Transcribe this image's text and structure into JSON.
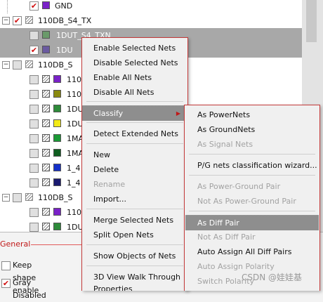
{
  "tree": {
    "rows": [
      {
        "label": "GND",
        "icon": "purple"
      },
      {
        "label": "110DB_S4_TX",
        "group": true
      },
      {
        "label": "1DUT_S4_TXN",
        "icon": "green"
      },
      {
        "label": "1DU",
        "icon": "purple"
      },
      {
        "label": "110DB_S",
        "group": true
      },
      {
        "label": "110",
        "icon": "purple"
      },
      {
        "label": "110",
        "icon": "olive"
      },
      {
        "label": "1DU",
        "icon": "green"
      },
      {
        "label": "1DU",
        "icon": "yellow"
      },
      {
        "label": "1MA",
        "icon": "green"
      },
      {
        "label": "1MA",
        "icon": "darkgreen"
      },
      {
        "label": "1_4",
        "icon": "blue"
      },
      {
        "label": "1_4",
        "icon": "navy"
      },
      {
        "label": "110DB_S",
        "group": true
      },
      {
        "label": "110",
        "icon": "purple"
      },
      {
        "label": "1DU",
        "icon": "green"
      }
    ]
  },
  "general": {
    "title": "General",
    "options": [
      {
        "label": "Keep shape enable"
      },
      {
        "label": "Gray Disabled"
      }
    ]
  },
  "context_menu": {
    "items": [
      {
        "label": "Enable Selected Nets"
      },
      {
        "label": "Disable Selected Nets"
      },
      {
        "label": "Enable All Nets"
      },
      {
        "label": "Disable All Nets"
      },
      {
        "label": "Classify"
      },
      {
        "label": "Detect Extended Nets"
      },
      {
        "label": "New"
      },
      {
        "label": "Delete"
      },
      {
        "label": "Rename"
      },
      {
        "label": "Import..."
      },
      {
        "label": "Merge Selected Nets"
      },
      {
        "label": "Split Open Nets"
      },
      {
        "label": "Show Objects of Nets"
      },
      {
        "label": "3D View Walk Through"
      },
      {
        "label": "Properties"
      }
    ]
  },
  "submenu": {
    "items": [
      {
        "label": "As PowerNets"
      },
      {
        "label": "As GroundNets"
      },
      {
        "label": "As Signal Nets"
      },
      {
        "label": "P/G nets classification wizard..."
      },
      {
        "label": "As Power-Ground Pair"
      },
      {
        "label": "Not As Power-Ground Pair"
      },
      {
        "label": "As Diff Pair"
      },
      {
        "label": "Not As Diff Pair"
      },
      {
        "label": "Auto Assign All Diff Pairs"
      },
      {
        "label": "Auto Assign Polarity"
      },
      {
        "label": "Switch Polarity"
      }
    ]
  },
  "watermark": "CSDN @娃娃基",
  "colors": {
    "accent": "#c43a3a",
    "highlight": "#8e8e8e",
    "selected_row": "#a8a8a8",
    "disabled_text": "#a2a2a2"
  }
}
